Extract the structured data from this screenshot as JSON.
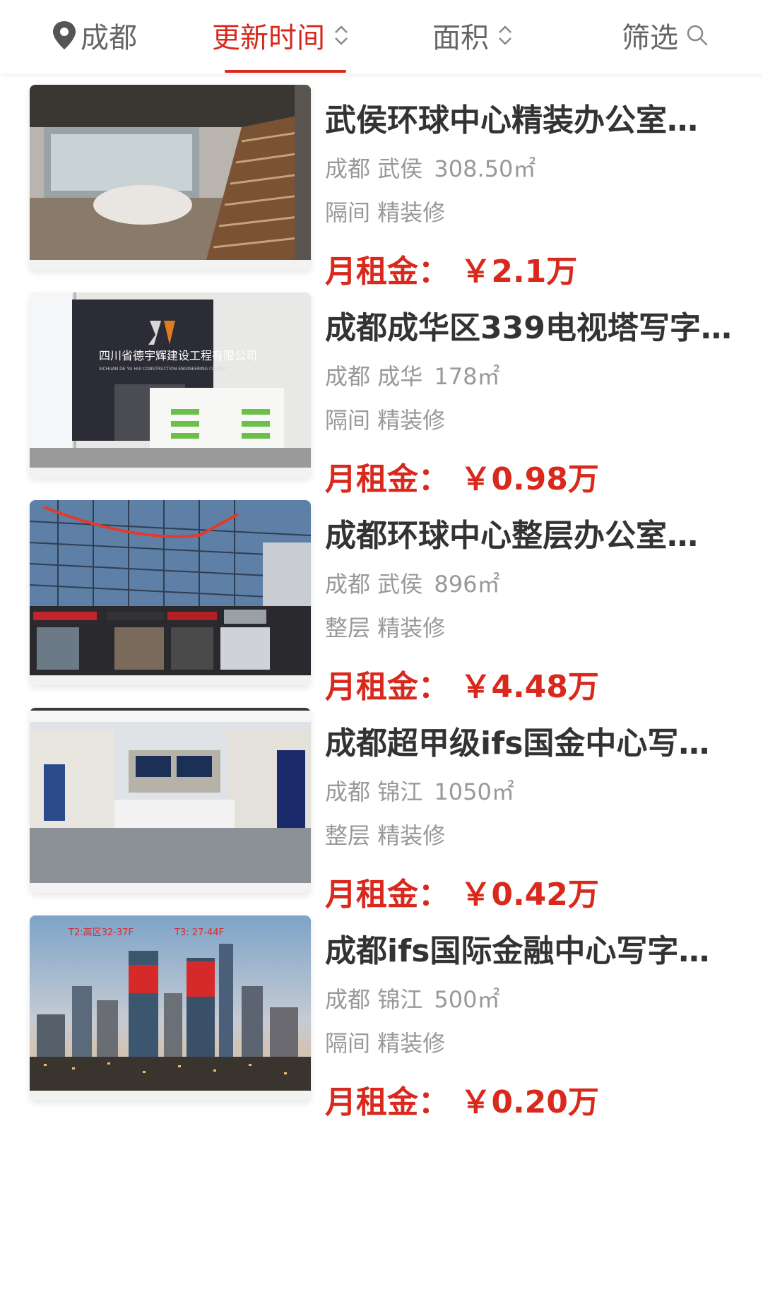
{
  "topbar": {
    "city": "成都",
    "sort_update": "更新时间",
    "sort_area": "面积",
    "filter": "筛选",
    "active_color": "#d9281c"
  },
  "listings": [
    {
      "title": "武侯环球中心精装办公室…",
      "city": "成都",
      "district": "武侯",
      "area": "308.50㎡",
      "partition": "隔间",
      "decoration": "精装修",
      "price_label": "月租金：",
      "price": "￥2.1万",
      "image": "office-lobby-staircase"
    },
    {
      "title": "成都成华区339电视塔写字…",
      "city": "成都",
      "district": "成华",
      "area": "178㎡",
      "partition": "隔间",
      "decoration": "精装修",
      "price_label": "月租金：",
      "price": "￥0.98万",
      "image": "reception-desk-logo-wall",
      "image_text": {
        "company_cn": "四川省德宇辉建设工程有限公司",
        "company_en": "SICHUAN DE YU HUI CONSTRUCTION ENGINEERING CO.,LTD"
      }
    },
    {
      "title": "成都环球中心整层办公室…",
      "city": "成都",
      "district": "武侯",
      "area": "896㎡",
      "partition": "整层",
      "decoration": "精装修",
      "price_label": "月租金：",
      "price": "￥4.48万",
      "image": "glass-office-building-exterior"
    },
    {
      "title": "成都超甲级ifs国金中心写…",
      "city": "成都",
      "district": "锦江",
      "area": "1050㎡",
      "partition": "整层",
      "decoration": "精装修",
      "price_label": "月租金：",
      "price": "￥0.42万",
      "image": "modern-reception-hall"
    },
    {
      "title": "成都ifs国际金融中心写字…",
      "city": "成都",
      "district": "锦江",
      "area": "500㎡",
      "partition": "隔间",
      "decoration": "精装修",
      "price_label": "月租金：",
      "price": "￥0.20万",
      "image": "city-skyline-towers",
      "image_text": {
        "tower_left": "T2:高区32-37F",
        "tower_right": "T3:  27-44F"
      }
    }
  ]
}
